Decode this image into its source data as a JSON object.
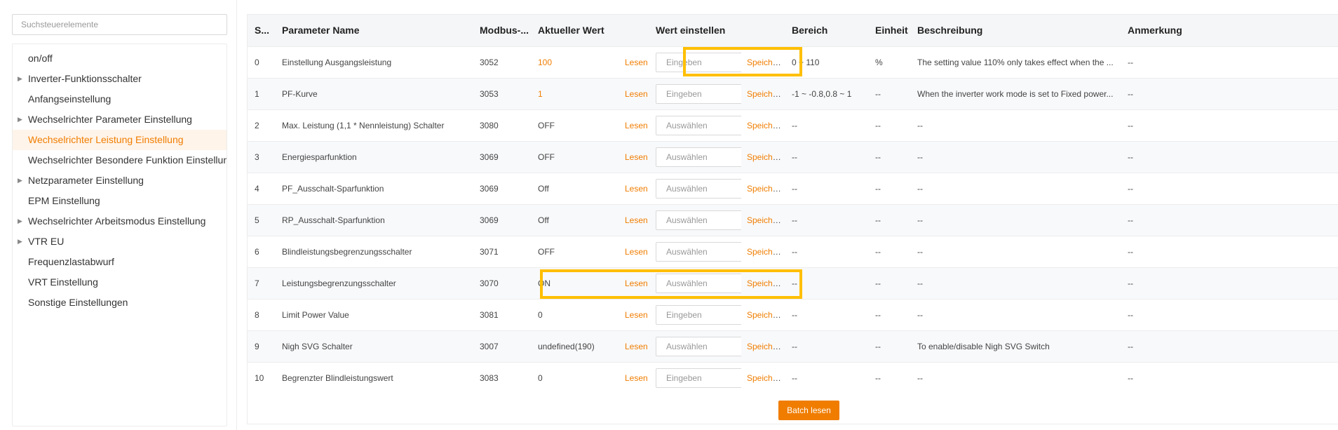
{
  "search": {
    "placeholder": "Suchsteuerelemente"
  },
  "tree": [
    {
      "label": "on/off",
      "expandable": false,
      "active": false
    },
    {
      "label": "Inverter-Funktionsschalter",
      "expandable": true,
      "active": false
    },
    {
      "label": "Anfangseinstellung",
      "expandable": false,
      "active": false
    },
    {
      "label": "Wechselrichter Parameter Einstellung",
      "expandable": true,
      "active": false
    },
    {
      "label": "Wechselrichter Leistung Einstellung",
      "expandable": false,
      "active": true
    },
    {
      "label": "Wechselrichter Besondere Funktion Einstellung",
      "expandable": false,
      "active": false
    },
    {
      "label": "Netzparameter Einstellung",
      "expandable": true,
      "active": false
    },
    {
      "label": "EPM Einstellung",
      "expandable": false,
      "active": false
    },
    {
      "label": "Wechselrichter Arbeitsmodus Einstellung",
      "expandable": true,
      "active": false
    },
    {
      "label": "VTR EU",
      "expandable": true,
      "active": false
    },
    {
      "label": "Frequenzlastabwurf",
      "expandable": false,
      "active": false
    },
    {
      "label": "VRT Einstellung",
      "expandable": false,
      "active": false
    },
    {
      "label": "Sonstige Einstellungen",
      "expandable": false,
      "active": false
    }
  ],
  "table": {
    "headers": [
      "S...",
      "Parameter Name",
      "Modbus-...",
      "Aktueller Wert",
      "",
      "Wert einstellen",
      "",
      "Bereich",
      "Einheit",
      "Beschreibung",
      "Anmerkung"
    ],
    "read_label": "Lesen",
    "save_label": "Speichern",
    "input_placeholder": "Eingeben",
    "select_placeholder": "Auswählen",
    "rows": [
      {
        "no": "0",
        "name": "Einstellung Ausgangsleistung",
        "modbus": "3052",
        "value": "100",
        "value_highlight": true,
        "control": "input",
        "range": "0 ~ 110",
        "unit": "%",
        "desc": "The setting value 110% only takes effect when the ...",
        "note": "--"
      },
      {
        "no": "1",
        "name": "PF-Kurve",
        "modbus": "3053",
        "value": "1",
        "value_highlight": true,
        "control": "input",
        "range": "-1 ~ -0.8,0.8 ~ 1",
        "unit": "--",
        "desc": "When the inverter work mode is set to Fixed power...",
        "note": "--"
      },
      {
        "no": "2",
        "name": "Max. Leistung (1,1 * Nennleistung) Schalter",
        "modbus": "3080",
        "value": "OFF",
        "value_highlight": false,
        "control": "select",
        "range": "--",
        "unit": "--",
        "desc": "--",
        "note": "--"
      },
      {
        "no": "3",
        "name": "Energiesparfunktion",
        "modbus": "3069",
        "value": "OFF",
        "value_highlight": false,
        "control": "select",
        "range": "--",
        "unit": "--",
        "desc": "--",
        "note": "--"
      },
      {
        "no": "4",
        "name": "PF_Ausschalt-Sparfunktion",
        "modbus": "3069",
        "value": "Off",
        "value_highlight": false,
        "control": "select",
        "range": "--",
        "unit": "--",
        "desc": "--",
        "note": "--"
      },
      {
        "no": "5",
        "name": "RP_Ausschalt-Sparfunktion",
        "modbus": "3069",
        "value": "Off",
        "value_highlight": false,
        "control": "select",
        "range": "--",
        "unit": "--",
        "desc": "--",
        "note": "--"
      },
      {
        "no": "6",
        "name": "Blindleistungsbegrenzungsschalter",
        "modbus": "3071",
        "value": "OFF",
        "value_highlight": false,
        "control": "select",
        "range": "--",
        "unit": "--",
        "desc": "--",
        "note": "--"
      },
      {
        "no": "7",
        "name": "Leistungsbegrenzungsschalter",
        "modbus": "3070",
        "value": "ON",
        "value_highlight": false,
        "control": "select",
        "range": "--",
        "unit": "--",
        "desc": "--",
        "note": "--"
      },
      {
        "no": "8",
        "name": "Limit Power Value",
        "modbus": "3081",
        "value": "0",
        "value_highlight": false,
        "control": "input",
        "range": "--",
        "unit": "--",
        "desc": "--",
        "note": "--"
      },
      {
        "no": "9",
        "name": "Nigh SVG Schalter",
        "modbus": "3007",
        "value": "undefined(190)",
        "value_highlight": false,
        "control": "select",
        "range": "--",
        "unit": "--",
        "desc": "To enable/disable Nigh SVG Switch",
        "note": "--"
      },
      {
        "no": "10",
        "name": "Begrenzter Blindleistungswert",
        "modbus": "3083",
        "value": "0",
        "value_highlight": false,
        "control": "input",
        "range": "--",
        "unit": "--",
        "desc": "--",
        "note": "--"
      }
    ]
  },
  "batch_button": "Batch lesen",
  "colors": {
    "accent": "#f07d00",
    "highlight": "#ffbf00",
    "active_bg": "#fff4ea"
  }
}
